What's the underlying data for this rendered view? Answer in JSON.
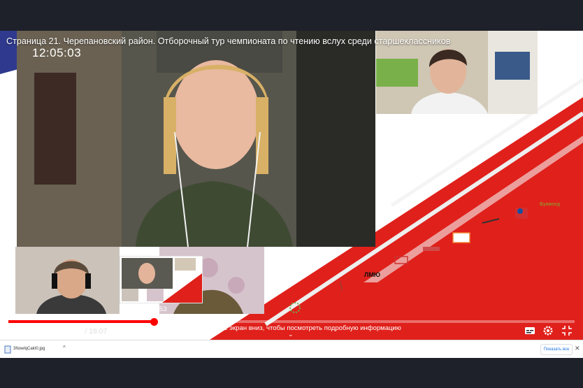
{
  "video": {
    "title": "Страница 21. Черепановский район. Отборочный тур чемпионата по чтению вслух среди старшеклассников",
    "clock": "12:05:03",
    "preview_time": "4:53",
    "progress": {
      "played_fraction": 0.257,
      "buffered_fraction": 0.265
    },
    "current_time": "4:41",
    "separator": "/",
    "duration": "18:07",
    "scroll_hint": "Прокрутите экран вниз, чтобы посмотреть подробную информацию",
    "scroll_chevron": "⌄"
  },
  "download_bar": {
    "file_name": "3NowlqCakt0.jpg",
    "caret": "^",
    "show_all": "Показать все",
    "close": "✕"
  },
  "logos": [
    "ЛМЮ",
    "Буквоед"
  ],
  "colors": {
    "accent": "#ff0000",
    "stripe_red": "#e0201b",
    "banner_blue": "#2f3a8f",
    "chrome_dark": "#1e2129"
  },
  "icons": [
    "pause-icon",
    "next-icon",
    "volume-icon",
    "subtitles-icon",
    "settings-icon",
    "fullscreen-exit-icon",
    "jpg-file-icon"
  ]
}
